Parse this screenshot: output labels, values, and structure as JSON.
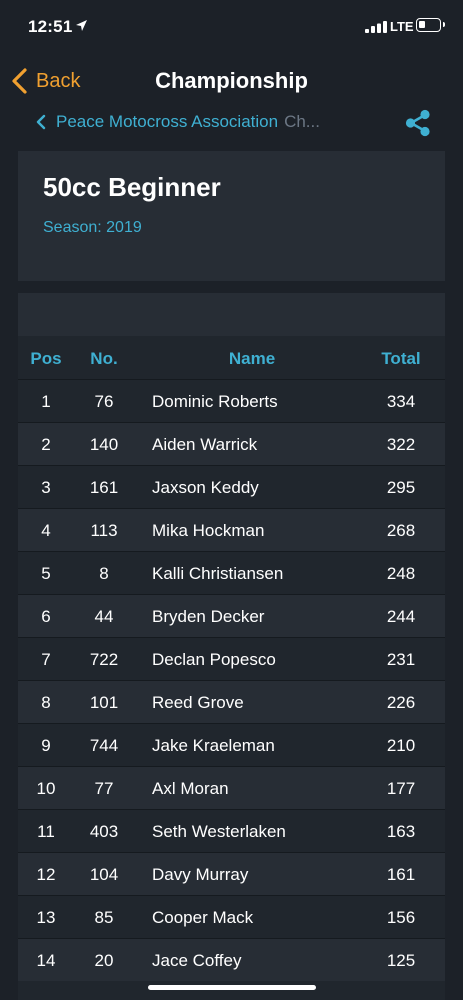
{
  "status_bar": {
    "time": "12:51",
    "network": "LTE"
  },
  "nav": {
    "back_label": "Back",
    "title": "Championship"
  },
  "breadcrumb": {
    "org": "Peace Motocross Association",
    "rest": "Ch..."
  },
  "header": {
    "class_name": "50cc Beginner",
    "season": "Season: 2019"
  },
  "table": {
    "columns": {
      "pos": "Pos",
      "no": "No.",
      "name": "Name",
      "total": "Total"
    },
    "rows": [
      {
        "pos": "1",
        "no": "76",
        "name": "Dominic Roberts",
        "total": "334"
      },
      {
        "pos": "2",
        "no": "140",
        "name": "Aiden Warrick",
        "total": "322"
      },
      {
        "pos": "3",
        "no": "161",
        "name": "Jaxson Keddy",
        "total": "295"
      },
      {
        "pos": "4",
        "no": "113",
        "name": "Mika Hockman",
        "total": "268"
      },
      {
        "pos": "5",
        "no": "8",
        "name": "Kalli Christiansen",
        "total": "248"
      },
      {
        "pos": "6",
        "no": "44",
        "name": "Bryden Decker",
        "total": "244"
      },
      {
        "pos": "7",
        "no": "722",
        "name": "Declan Popesco",
        "total": "231"
      },
      {
        "pos": "8",
        "no": "101",
        "name": "Reed Grove",
        "total": "226"
      },
      {
        "pos": "9",
        "no": "744",
        "name": "Jake Kraeleman",
        "total": "210"
      },
      {
        "pos": "10",
        "no": "77",
        "name": "Axl Moran",
        "total": "177"
      },
      {
        "pos": "11",
        "no": "403",
        "name": "Seth Westerlaken",
        "total": "163"
      },
      {
        "pos": "12",
        "no": "104",
        "name": "Davy Murray",
        "total": "161"
      },
      {
        "pos": "13",
        "no": "85",
        "name": "Cooper Mack",
        "total": "156"
      },
      {
        "pos": "14",
        "no": "20",
        "name": "Jace Coffey",
        "total": "125"
      }
    ]
  },
  "colors": {
    "accent": "#3fb0d2",
    "back": "#f0a030",
    "background": "#1c2128",
    "card": "#272d35"
  },
  "icons": {
    "status": [
      "location-arrow-icon",
      "signal-icon",
      "battery-icon"
    ],
    "nav": [
      "chevron-left-icon",
      "share-icon"
    ]
  }
}
